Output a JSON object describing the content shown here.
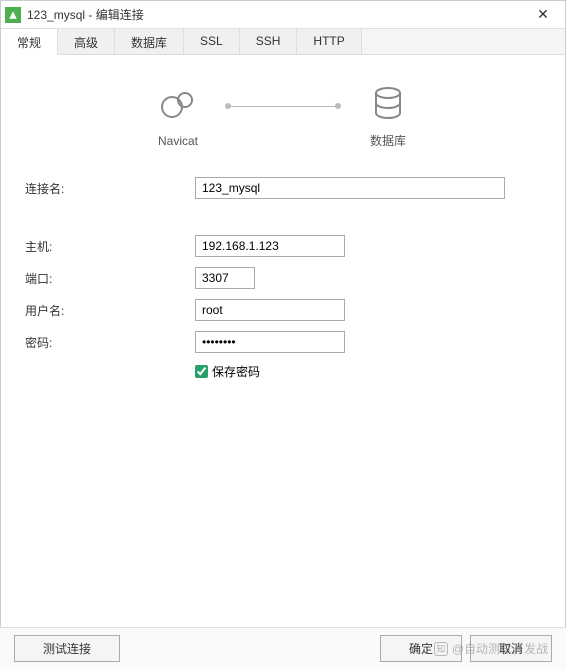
{
  "window": {
    "title": "123_mysql - 编辑连接"
  },
  "tabs": {
    "general": "常规",
    "advanced": "高级",
    "database": "数据库",
    "ssl": "SSL",
    "ssh": "SSH",
    "http": "HTTP"
  },
  "visual": {
    "left_label": "Navicat",
    "right_label": "数据库"
  },
  "form": {
    "conn_name_label": "连接名:",
    "conn_name_value": "123_mysql",
    "host_label": "主机:",
    "host_value": "192.168.1.123",
    "port_label": "端口:",
    "port_value": "3307",
    "user_label": "用户名:",
    "user_value": "root",
    "pass_label": "密码:",
    "pass_value": "••••••••",
    "save_pass_label": "保存密码"
  },
  "footer": {
    "test": "测试连接",
    "ok": "确定",
    "cancel": "取消"
  },
  "watermark": {
    "logo": "知",
    "text": "@自动测试开发战"
  }
}
